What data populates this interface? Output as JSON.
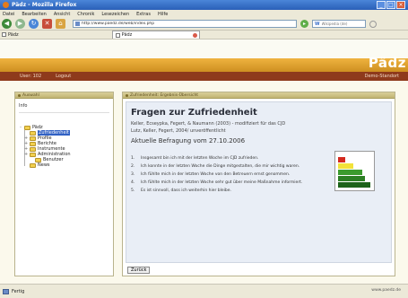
{
  "window": {
    "title": "Pädz - Mozilla Firefox"
  },
  "menu": [
    "Datei",
    "Bearbeiten",
    "Ansicht",
    "Chronik",
    "Lesezeichen",
    "Extras",
    "Hilfe"
  ],
  "url": "http://www.paedz.de/web/index.php",
  "search_placeholder": "Wikipedia (de)",
  "bookmarks": [
    {
      "label": "Pädz"
    }
  ],
  "tab": {
    "label": "Pädz"
  },
  "app": {
    "brand": "Pädz",
    "user_link": "User: 102",
    "logout_link": "Logout",
    "right_link": "Demo-Standort"
  },
  "left_panel": {
    "header": "Auswahl",
    "subtitle": "Info",
    "tree": [
      {
        "label": "Pädz",
        "level": 0,
        "expander": "-"
      },
      {
        "label": "Zufriedenheit",
        "level": 1,
        "expander": "",
        "selected": true
      },
      {
        "label": "Profile",
        "level": 1,
        "expander": "+"
      },
      {
        "label": "Berichte",
        "level": 1,
        "expander": "+"
      },
      {
        "label": "Instrumente",
        "level": 1,
        "expander": "+"
      },
      {
        "label": "Administration",
        "level": 1,
        "expander": "+"
      },
      {
        "label": "Benutzer",
        "level": 2,
        "expander": ""
      },
      {
        "label": "News",
        "level": 1,
        "expander": ""
      }
    ]
  },
  "right_panel": {
    "header": "Zufriedenheit: Ergebnis-Übersicht",
    "title": "Fragen zur Zufriedenheit",
    "authors_line1": "Keller, Ecseypka, Fegert, & Naumann (2003) - modifiziert für das CJD",
    "authors_line2": "Lutz, Keller, Fegert, 2004/ unveröffentlicht",
    "subtitle": "Aktuelle Befragung vom 27.10.2006",
    "questions": [
      {
        "num": "1.",
        "text": "Insgesamt bin ich mit der letzten Woche im CJD zufrieden."
      },
      {
        "num": "2.",
        "text": "Ich konnte in der letzten Woche die Dinge mitgestalten, die mir wichtig waren."
      },
      {
        "num": "3.",
        "text": "Ich fühlte mich in der letzten Woche von den Betreuern ernst genommen."
      },
      {
        "num": "4.",
        "text": "Ich fühlte mich in der letzten Woche sehr gut über meine Maßnahme informiert."
      },
      {
        "num": "5.",
        "text": "Es ist sinnvoll, dass ich weiterhin hier bleibe."
      }
    ],
    "rating_colors": [
      "#d42a1f",
      "#f2e23a",
      "#3c9b2e",
      "#2d7f25",
      "#1c6319"
    ],
    "rating_levels": [
      0.2,
      0.45,
      0.7,
      0.8,
      0.95
    ],
    "bottom_button": "Zurück"
  },
  "status": {
    "left": "Fertig",
    "right": "www.paedz.de"
  }
}
